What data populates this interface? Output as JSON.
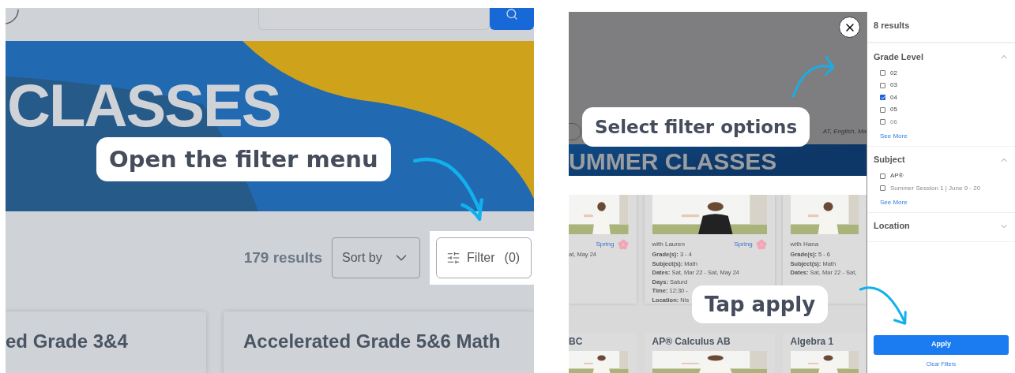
{
  "step_open": {
    "callout": "Open the filter menu",
    "banner_title": "CLASSES",
    "results": "179 results",
    "sort": "Sort by",
    "filter_button": {
      "label": "Filter",
      "count": "(0)"
    },
    "cards": [
      {
        "title": "ed Grade 3&4"
      },
      {
        "title": "Accelerated Grade 5&6 Math"
      }
    ]
  },
  "step_select": {
    "callout": "Select filter options",
    "chip_text": "AT, English, Ma",
    "banner_title": "UMMER CLASSES"
  },
  "step_apply": {
    "callout": "Tap apply",
    "cards": [
      {
        "season": "Spring",
        "lines": [
          "at, May 24"
        ]
      },
      {
        "teacher": "with Lauren",
        "season": "Spring",
        "lines": [
          "**Grade(s):** 3 - 4",
          "**Subject(s):** Math",
          "**Dates:** Sat, Mar 22 - Sat, May 24",
          "**Days:** Saturd",
          "**Time:** 12:30 -",
          "**Location:** Nis"
        ]
      },
      {
        "teacher": "with Hana",
        "lines": [
          "**Grade(s):** 5 - 6",
          "**Subject(s):** Math",
          "**Dates:** Sat, Mar 22 - Sat,"
        ]
      }
    ],
    "next_titles": [
      "BC",
      "AP® Calculus AB",
      "Algebra 1"
    ]
  },
  "filter_panel": {
    "results": "8 results",
    "sections": [
      {
        "title": "Grade Level",
        "expanded": true,
        "options": [
          {
            "label": "02",
            "checked": false,
            "faded": false
          },
          {
            "label": "03",
            "checked": false,
            "faded": false
          },
          {
            "label": "04",
            "checked": true,
            "faded": false
          },
          {
            "label": "05",
            "checked": false,
            "faded": false
          },
          {
            "label": "06",
            "checked": false,
            "faded": true
          }
        ],
        "see_more": "See More"
      },
      {
        "title": "Subject",
        "expanded": true,
        "options": [
          {
            "label": "AP®",
            "checked": false,
            "faded": false
          },
          {
            "label": "Summer Session 1 | June 9 - 20",
            "checked": false,
            "faded": true
          }
        ],
        "see_more": "See More"
      },
      {
        "title": "Location",
        "expanded": false
      }
    ],
    "apply": "Apply",
    "clear": "Clear Filters"
  }
}
